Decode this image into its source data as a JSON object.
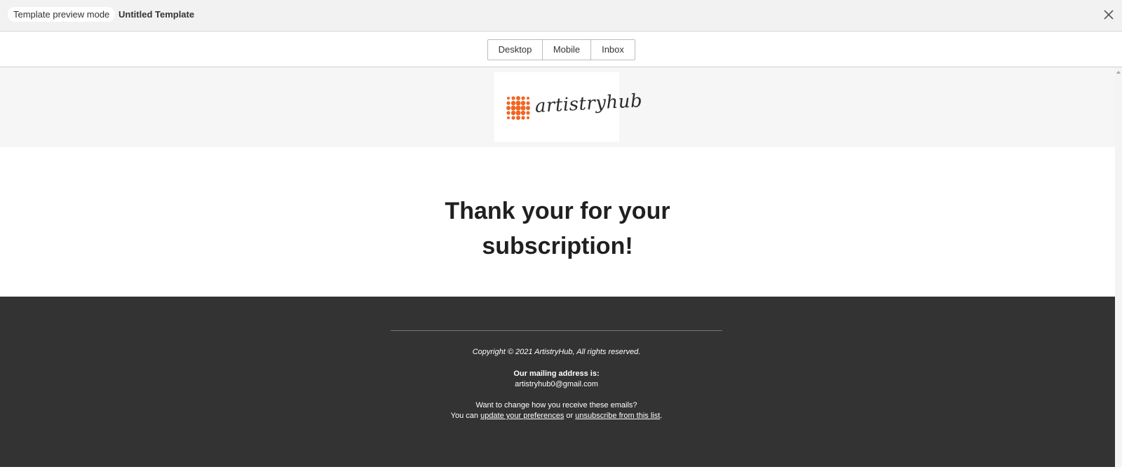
{
  "topbar": {
    "mode_label": "Template preview mode",
    "template_name": "Untitled Template",
    "close_icon": "close-icon"
  },
  "view_switcher": {
    "options": [
      "Desktop",
      "Mobile",
      "Inbox"
    ]
  },
  "email": {
    "logo_text": "artistryhub",
    "logo_colors": {
      "dots": "#f26522",
      "text": "#2a2a2a"
    },
    "headline_line1": "Thank your for your",
    "headline_line2": "subscription!",
    "footer": {
      "copyright": "Copyright © 2021 ArtistryHub, All rights reserved.",
      "mailing_label": "Our mailing address is:",
      "mailing_address": "artistryhub0@gmail.com",
      "change_question": "Want to change how you receive these emails?",
      "you_can": "You can ",
      "update_link": "update your preferences",
      "or_text": " or ",
      "unsubscribe_link": "unsubscribe from this list",
      "period": "."
    }
  },
  "colors": {
    "topbar_bg": "#f2f2f2",
    "header_band_bg": "#f6f6f6",
    "footer_bg": "#333333",
    "headline": "#202020"
  }
}
